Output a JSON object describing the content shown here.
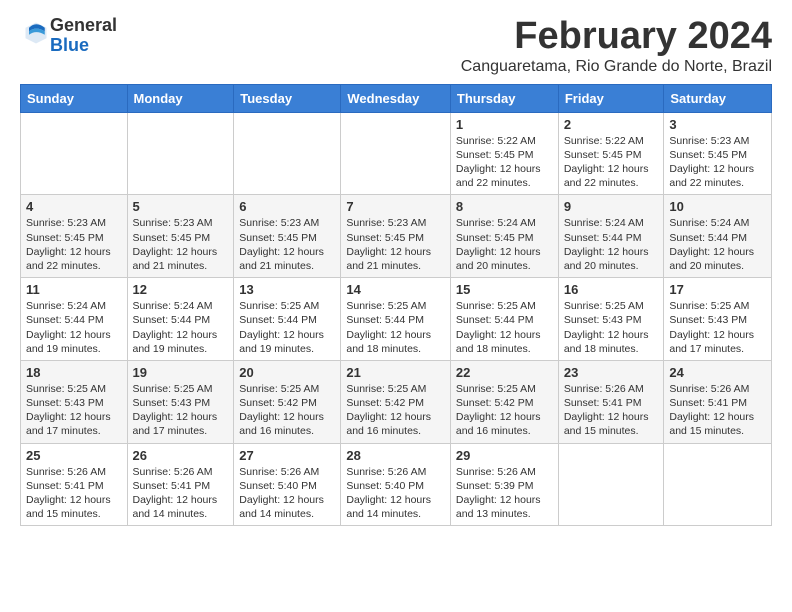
{
  "logo": {
    "general": "General",
    "blue": "Blue"
  },
  "title": "February 2024",
  "location": "Canguaretama, Rio Grande do Norte, Brazil",
  "days_of_week": [
    "Sunday",
    "Monday",
    "Tuesday",
    "Wednesday",
    "Thursday",
    "Friday",
    "Saturday"
  ],
  "weeks": [
    [
      {
        "day": "",
        "detail": ""
      },
      {
        "day": "",
        "detail": ""
      },
      {
        "day": "",
        "detail": ""
      },
      {
        "day": "",
        "detail": ""
      },
      {
        "day": "1",
        "detail": "Sunrise: 5:22 AM\nSunset: 5:45 PM\nDaylight: 12 hours\nand 22 minutes."
      },
      {
        "day": "2",
        "detail": "Sunrise: 5:22 AM\nSunset: 5:45 PM\nDaylight: 12 hours\nand 22 minutes."
      },
      {
        "day": "3",
        "detail": "Sunrise: 5:23 AM\nSunset: 5:45 PM\nDaylight: 12 hours\nand 22 minutes."
      }
    ],
    [
      {
        "day": "4",
        "detail": "Sunrise: 5:23 AM\nSunset: 5:45 PM\nDaylight: 12 hours\nand 22 minutes."
      },
      {
        "day": "5",
        "detail": "Sunrise: 5:23 AM\nSunset: 5:45 PM\nDaylight: 12 hours\nand 21 minutes."
      },
      {
        "day": "6",
        "detail": "Sunrise: 5:23 AM\nSunset: 5:45 PM\nDaylight: 12 hours\nand 21 minutes."
      },
      {
        "day": "7",
        "detail": "Sunrise: 5:23 AM\nSunset: 5:45 PM\nDaylight: 12 hours\nand 21 minutes."
      },
      {
        "day": "8",
        "detail": "Sunrise: 5:24 AM\nSunset: 5:45 PM\nDaylight: 12 hours\nand 20 minutes."
      },
      {
        "day": "9",
        "detail": "Sunrise: 5:24 AM\nSunset: 5:44 PM\nDaylight: 12 hours\nand 20 minutes."
      },
      {
        "day": "10",
        "detail": "Sunrise: 5:24 AM\nSunset: 5:44 PM\nDaylight: 12 hours\nand 20 minutes."
      }
    ],
    [
      {
        "day": "11",
        "detail": "Sunrise: 5:24 AM\nSunset: 5:44 PM\nDaylight: 12 hours\nand 19 minutes."
      },
      {
        "day": "12",
        "detail": "Sunrise: 5:24 AM\nSunset: 5:44 PM\nDaylight: 12 hours\nand 19 minutes."
      },
      {
        "day": "13",
        "detail": "Sunrise: 5:25 AM\nSunset: 5:44 PM\nDaylight: 12 hours\nand 19 minutes."
      },
      {
        "day": "14",
        "detail": "Sunrise: 5:25 AM\nSunset: 5:44 PM\nDaylight: 12 hours\nand 18 minutes."
      },
      {
        "day": "15",
        "detail": "Sunrise: 5:25 AM\nSunset: 5:44 PM\nDaylight: 12 hours\nand 18 minutes."
      },
      {
        "day": "16",
        "detail": "Sunrise: 5:25 AM\nSunset: 5:43 PM\nDaylight: 12 hours\nand 18 minutes."
      },
      {
        "day": "17",
        "detail": "Sunrise: 5:25 AM\nSunset: 5:43 PM\nDaylight: 12 hours\nand 17 minutes."
      }
    ],
    [
      {
        "day": "18",
        "detail": "Sunrise: 5:25 AM\nSunset: 5:43 PM\nDaylight: 12 hours\nand 17 minutes."
      },
      {
        "day": "19",
        "detail": "Sunrise: 5:25 AM\nSunset: 5:43 PM\nDaylight: 12 hours\nand 17 minutes."
      },
      {
        "day": "20",
        "detail": "Sunrise: 5:25 AM\nSunset: 5:42 PM\nDaylight: 12 hours\nand 16 minutes."
      },
      {
        "day": "21",
        "detail": "Sunrise: 5:25 AM\nSunset: 5:42 PM\nDaylight: 12 hours\nand 16 minutes."
      },
      {
        "day": "22",
        "detail": "Sunrise: 5:25 AM\nSunset: 5:42 PM\nDaylight: 12 hours\nand 16 minutes."
      },
      {
        "day": "23",
        "detail": "Sunrise: 5:26 AM\nSunset: 5:41 PM\nDaylight: 12 hours\nand 15 minutes."
      },
      {
        "day": "24",
        "detail": "Sunrise: 5:26 AM\nSunset: 5:41 PM\nDaylight: 12 hours\nand 15 minutes."
      }
    ],
    [
      {
        "day": "25",
        "detail": "Sunrise: 5:26 AM\nSunset: 5:41 PM\nDaylight: 12 hours\nand 15 minutes."
      },
      {
        "day": "26",
        "detail": "Sunrise: 5:26 AM\nSunset: 5:41 PM\nDaylight: 12 hours\nand 14 minutes."
      },
      {
        "day": "27",
        "detail": "Sunrise: 5:26 AM\nSunset: 5:40 PM\nDaylight: 12 hours\nand 14 minutes."
      },
      {
        "day": "28",
        "detail": "Sunrise: 5:26 AM\nSunset: 5:40 PM\nDaylight: 12 hours\nand 14 minutes."
      },
      {
        "day": "29",
        "detail": "Sunrise: 5:26 AM\nSunset: 5:39 PM\nDaylight: 12 hours\nand 13 minutes."
      },
      {
        "day": "",
        "detail": ""
      },
      {
        "day": "",
        "detail": ""
      }
    ]
  ]
}
